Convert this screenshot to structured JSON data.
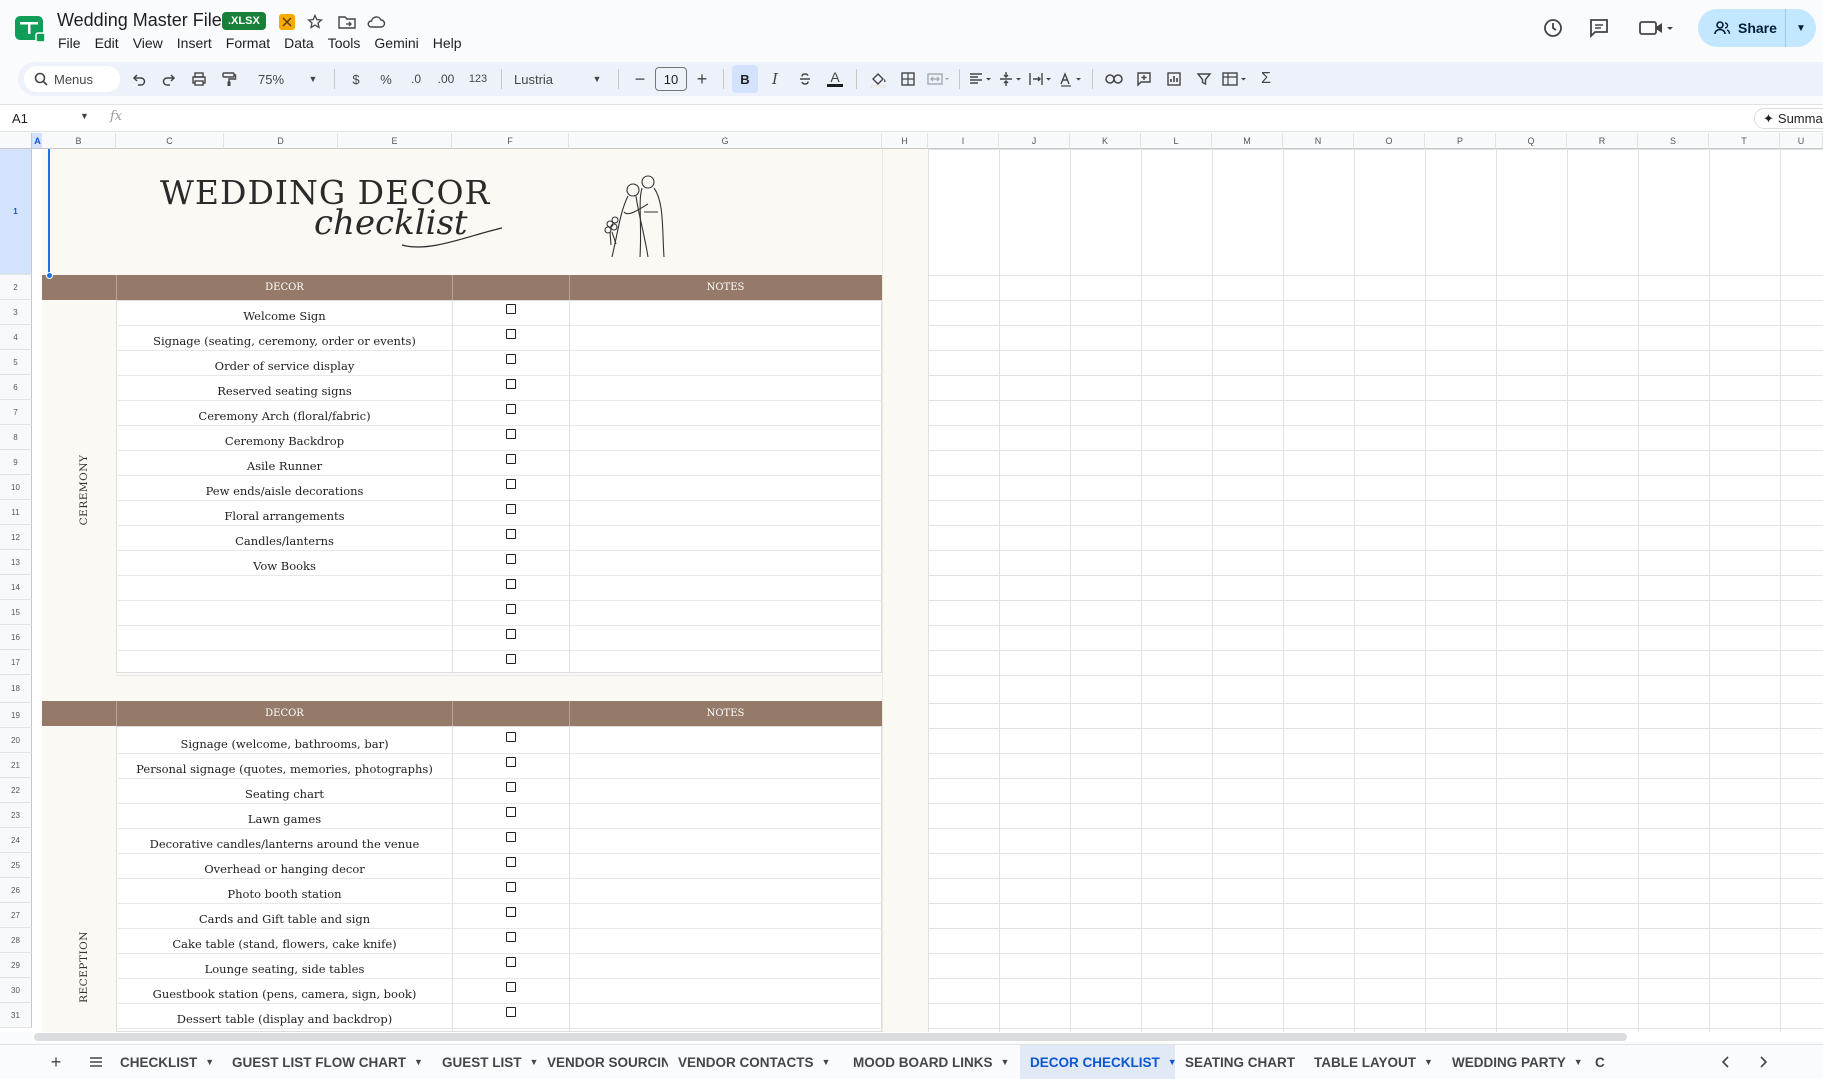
{
  "app": {
    "doc_title": "Wedding Master File",
    "file_badge": ".XLSX",
    "menu": [
      "File",
      "Edit",
      "View",
      "Insert",
      "Format",
      "Data",
      "Tools",
      "Gemini",
      "Help"
    ],
    "share_label": "Share"
  },
  "toolbar": {
    "search_label": "Menus",
    "zoom": "75%",
    "currency": "$",
    "percent": "%",
    "dec_decrease": ".0",
    "dec_increase": ".00",
    "number_format": "123",
    "font_name": "Lustria",
    "font_size": "10",
    "bold": "B",
    "italic": "I",
    "text_color": "A",
    "sum": "Σ"
  },
  "formula_bar": {
    "cell_ref": "A1",
    "fx": "fx",
    "summarize": "Summa"
  },
  "columns": [
    "A",
    "B",
    "C",
    "D",
    "E",
    "F",
    "G",
    "H",
    "I",
    "J",
    "K",
    "L",
    "M",
    "N",
    "O",
    "P",
    "Q",
    "R",
    "S",
    "T",
    "U"
  ],
  "rows": [
    "1",
    "2",
    "3",
    "4",
    "5",
    "6",
    "7",
    "8",
    "9",
    "10",
    "11",
    "12",
    "13",
    "14",
    "15",
    "16",
    "17",
    "18",
    "19",
    "20",
    "21",
    "22",
    "23",
    "24",
    "25",
    "26",
    "27",
    "28",
    "29",
    "30",
    "31"
  ],
  "sheet": {
    "title_line1": "WEDDING DECOR",
    "title_line2": "checklist",
    "decor_header": "DECOR",
    "notes_header": "NOTES",
    "ceremony_label": "CEREMONY",
    "reception_label": "RECEPTION",
    "ceremony_items": [
      "Welcome Sign",
      "Signage (seating, ceremony, order or events)",
      "Order of service display",
      "Reserved seating signs",
      "Ceremony Arch (floral/fabric)",
      "Ceremony Backdrop",
      "Asile Runner",
      "Pew ends/aisle decorations",
      "Floral arrangements",
      "Candles/lanterns",
      "Vow Books",
      "",
      "",
      "",
      ""
    ],
    "reception_items": [
      "Signage (welcome, bathrooms, bar)",
      "Personal signage (quotes, memories, photographs)",
      "Seating chart",
      "Lawn games",
      "Decorative candles/lanterns around the venue",
      "Overhead or hanging decor",
      "Photo booth station",
      "Cards and Gift table and sign",
      "Cake table (stand, flowers, cake knife)",
      "Lounge seating, side tables",
      "Guestbook station (pens, camera, sign, book)",
      "Dessert table (display and backdrop)"
    ]
  },
  "tabs": [
    {
      "label": "CHECKLIST",
      "active": false
    },
    {
      "label": "GUEST LIST FLOW CHART",
      "active": false
    },
    {
      "label": "GUEST LIST",
      "active": false
    },
    {
      "label": "VENDOR SOURCING",
      "active": false
    },
    {
      "label": "VENDOR CONTACTS",
      "active": false
    },
    {
      "label": "MOOD BOARD LINKS",
      "active": false
    },
    {
      "label": "DECOR CHECKLIST",
      "active": true
    },
    {
      "label": "SEATING CHART",
      "active": false
    },
    {
      "label": "TABLE LAYOUT",
      "active": false
    },
    {
      "label": "WEDDING PARTY",
      "active": false
    },
    {
      "label": "C",
      "active": false
    }
  ],
  "colors": {
    "band": "#957a6a",
    "cream": "#fbf9f4",
    "accent": "#0b57d0",
    "share_bg": "#c2e7ff"
  }
}
